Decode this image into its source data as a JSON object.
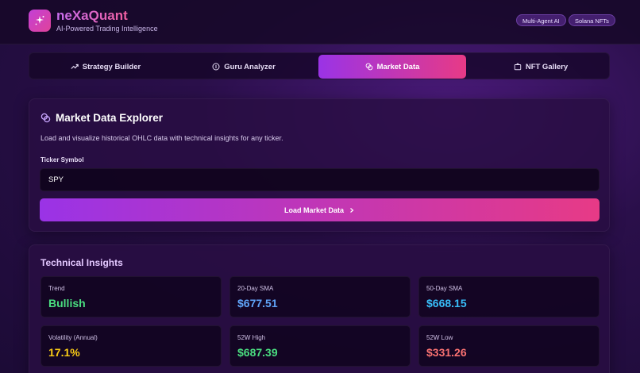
{
  "header": {
    "brand": "neXaQuant",
    "tagline": "AI-Powered Trading Intelligence",
    "badges": [
      "Multi-Agent AI",
      "Solana NFTs"
    ]
  },
  "tabs": [
    {
      "label": "Strategy Builder",
      "icon": "trend-up-icon"
    },
    {
      "label": "Guru Analyzer",
      "icon": "info-circle-icon"
    },
    {
      "label": "Market Data",
      "icon": "coins-icon",
      "active": true
    },
    {
      "label": "NFT Gallery",
      "icon": "image-icon"
    }
  ],
  "explorer": {
    "title": "Market Data Explorer",
    "description": "Load and visualize historical OHLC data with technical insights for any ticker.",
    "ticker_label": "Ticker Symbol",
    "ticker_value": "SPY",
    "load_button": "Load Market Data"
  },
  "insights": {
    "title": "Technical Insights",
    "cards": [
      {
        "label": "Trend",
        "value": "Bullish",
        "color": "#4ade80"
      },
      {
        "label": "20-Day SMA",
        "value": "$677.51",
        "color": "#60a5fa"
      },
      {
        "label": "50-Day SMA",
        "value": "$668.15",
        "color": "#38bdf8"
      },
      {
        "label": "Volatility (Annual)",
        "value": "17.1%",
        "color": "#facc15"
      },
      {
        "label": "52W High",
        "value": "$687.39",
        "color": "#4ade80"
      },
      {
        "label": "52W Low",
        "value": "$331.26",
        "color": "#f87171"
      }
    ]
  },
  "colors": {
    "accent_start": "#9a33e6",
    "accent_end": "#e73a86",
    "background": "#2a0f4a"
  }
}
